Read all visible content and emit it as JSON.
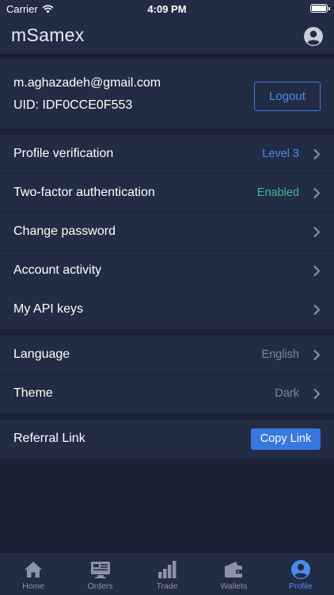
{
  "status_bar": {
    "carrier": "Carrier",
    "time": "4:09 PM"
  },
  "app": {
    "title": "mSamex"
  },
  "account": {
    "email": "m.aghazadeh@gmail.com",
    "uid": "UID: IDF0CCE0F553",
    "logout_label": "Logout"
  },
  "security_items": [
    {
      "label": "Profile verification",
      "value": "Level 3"
    },
    {
      "label": "Two-factor authentication",
      "value": "Enabled"
    },
    {
      "label": "Change password",
      "value": ""
    },
    {
      "label": "Account activity",
      "value": ""
    },
    {
      "label": "My API keys",
      "value": ""
    }
  ],
  "preferences": [
    {
      "label": "Language",
      "value": "English"
    },
    {
      "label": "Theme",
      "value": "Dark"
    }
  ],
  "referral": {
    "label": "Referral Link",
    "button_label": "Copy Link"
  },
  "tabs": [
    {
      "label": "Home",
      "icon": "home-icon"
    },
    {
      "label": "Orders",
      "icon": "orders-icon"
    },
    {
      "label": "Trade",
      "icon": "trade-icon"
    },
    {
      "label": "Wallets",
      "icon": "wallet-icon"
    },
    {
      "label": "Profile",
      "icon": "profile-icon",
      "active": true
    }
  ],
  "colors": {
    "background": "#1b2235",
    "surface": "#232c45",
    "accent": "#4a8bee",
    "success": "#3db68f",
    "muted": "#7d869c"
  }
}
